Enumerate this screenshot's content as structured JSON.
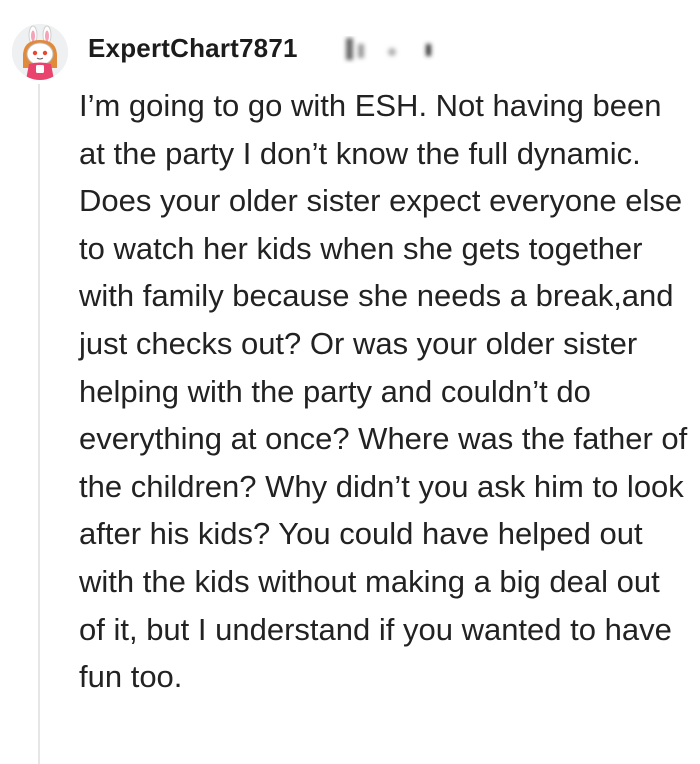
{
  "comment": {
    "author": {
      "username": "ExpertChart7871",
      "avatar_icon": "snoo-bunny-avatar-icon"
    },
    "body": "I’m going to go with ESH. Not having been at the party I don’t know the full dynamic. Does your older sister expect everyone else to watch her kids when she gets together with family because she needs a break,and just checks out? Or was your older sister helping with the party and couldn’t do everything at once? Where was the father of the children? Why didn’t you ask him to look after his kids? You could have helped out with the kids without making a big deal out of it, but I understand if you wanted to have fun too."
  },
  "colors": {
    "thread_line": "#e6e6e6",
    "avatar_bg": "#eef0f2",
    "text": "#222222"
  }
}
